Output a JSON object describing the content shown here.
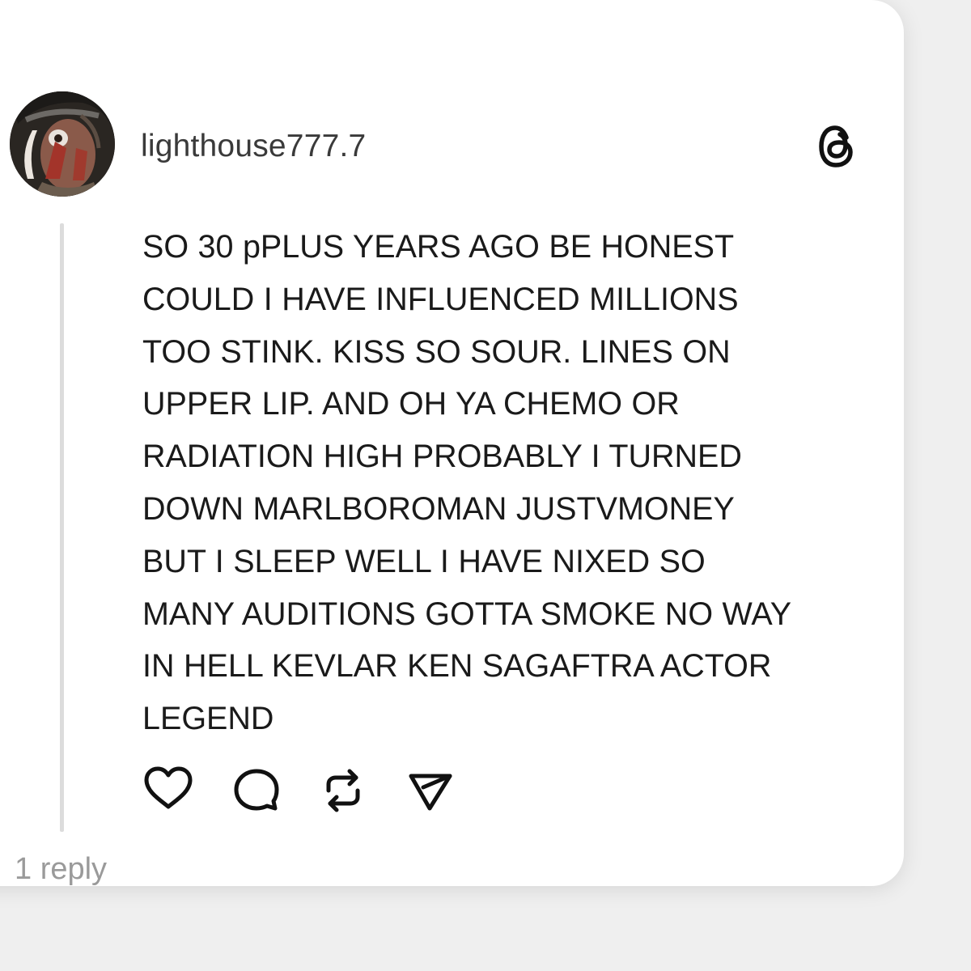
{
  "post": {
    "username": "lighthouse777.7",
    "text": "SO 30 pPLUS YEARS AGO BE HONEST\nCOULD I HAVE INFLUENCED MILLIONS\nTOO STINK. KISS SO SOUR.  LINES ON\nUPPER LIP. AND OH YA CHEMO OR\nRADIATION HIGH PROBABLY  I TURNED\nDOWN MARLBOROMAN JUSTVMONEY\nBUT I SLEEP WELL I HAVE NIXED SO\nMANY AUDITIONS GOTTA SMOKE NO WAY\nIN HELL KEVLAR KEN SAGAFTRA ACTOR\nLEGEND",
    "reply_count_label": "1 reply",
    "avatar_icon": "profile-avatar",
    "brand_icon": "threads-logo-icon",
    "actions": [
      {
        "icon": "heart-icon",
        "label": "like"
      },
      {
        "icon": "comment-icon",
        "label": "reply"
      },
      {
        "icon": "repost-icon",
        "label": "repost"
      },
      {
        "icon": "send-icon",
        "label": "share"
      }
    ]
  },
  "colors": {
    "background": "#efefef",
    "card": "#ffffff",
    "text": "#1a1a1a",
    "username": "#3a3a3a",
    "muted": "#9a9a9a",
    "thread_line": "#dcdcdc"
  }
}
